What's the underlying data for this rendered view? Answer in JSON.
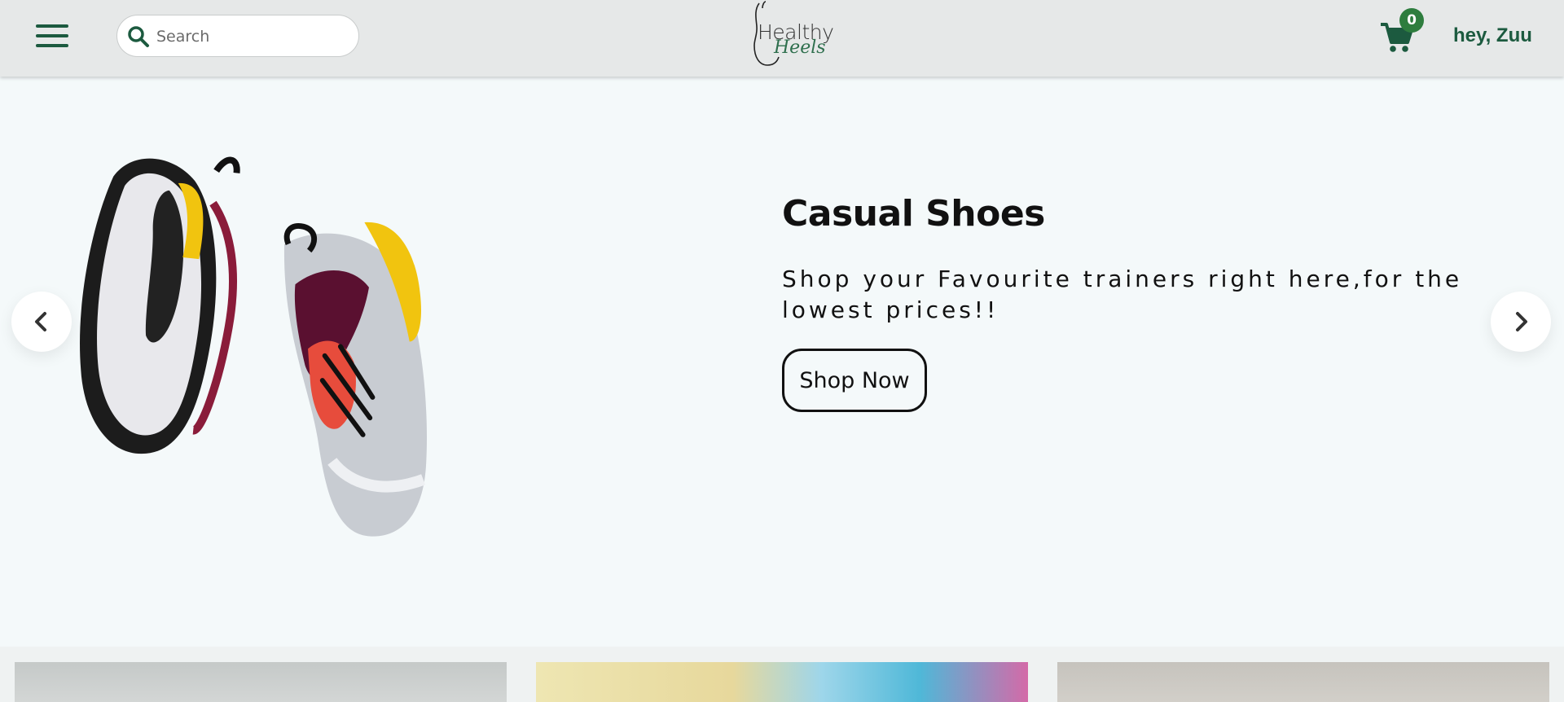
{
  "header": {
    "search_placeholder": "Search",
    "logo_top": "Healthy",
    "logo_bottom": "Heels",
    "cart_count": "0",
    "greeting": "hey, Zuu"
  },
  "hero": {
    "title": "Casual Shoes",
    "text": "Shop your Favourite trainers right here,for the lowest prices!!",
    "button": "Shop Now"
  },
  "icons": [
    "menu-icon",
    "search-icon",
    "cart-icon",
    "chevron-left-icon",
    "chevron-right-icon"
  ],
  "colors": {
    "accent": "#1c5a3f",
    "badge": "#2e7d3e",
    "header_bg": "#e6e8e8",
    "page_bg": "#f4f9fa"
  }
}
